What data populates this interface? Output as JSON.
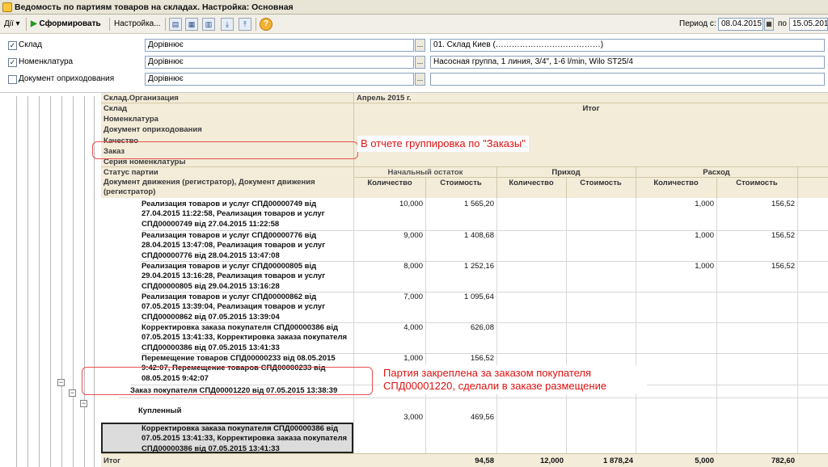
{
  "window": {
    "title": "Ведомость по партиям товаров на складах. Настройка: Основная"
  },
  "toolbar": {
    "actions_label": "Дії",
    "generate_label": "Сформировать",
    "settings_label": "Настройка...",
    "period_label": "Период с:",
    "period_from": "08.04.2015",
    "period_to_label": "по",
    "period_to": "15.05.2015"
  },
  "filters": [
    {
      "label": "Склад",
      "checked": true,
      "condition": "Дорівнює",
      "value": "01. Склад Киев (…………………………………)"
    },
    {
      "label": "Номенклатура",
      "checked": true,
      "condition": "Дорівнює",
      "value": "Насосная группа, 1 линия, 3/4\", 1-6 l/min, Wilo ST25/4"
    },
    {
      "label": "Документ оприходования",
      "checked": false,
      "condition": "Дорівнює",
      "value": ""
    }
  ],
  "report": {
    "row_headers": [
      "Склад.Организация",
      "Склад",
      "Номенклатура",
      "Документ оприходования",
      "Качество",
      "Заказ",
      "Серия номенклатуры",
      "Статус партии",
      "Документ движения (регистратор), Документ движения (регистратор)"
    ],
    "period": "Апрель 2015 г.",
    "itog_label": "Итог",
    "group_start": "Начальный остаток",
    "group_income": "Приход",
    "group_outgo": "Расход",
    "col_qty": "Количество",
    "col_cost": "Стоимость",
    "rows": [
      {
        "text": "Реализация товаров и услуг СПД00000749 від 27.04.2015 11:22:58, Реализация товаров и услуг СПД00000749 від 27.04.2015 11:22:58",
        "start_qty": "10,000",
        "start_cost": "1 565,20",
        "out_qty": "1,000",
        "out_cost": "156,52"
      },
      {
        "text": "Реализация товаров и услуг СПД00000776 від 28.04.2015 13:47:08, Реализация товаров и услуг СПД00000776 від 28.04.2015 13:47:08",
        "start_qty": "9,000",
        "start_cost": "1 408,68",
        "out_qty": "1,000",
        "out_cost": "156,52"
      },
      {
        "text": "Реализация товаров и услуг СПД00000805 від 29.04.2015 13:16:28, Реализация товаров и услуг СПД00000805 від 29.04.2015 13:16:28",
        "start_qty": "8,000",
        "start_cost": "1 252,16",
        "out_qty": "1,000",
        "out_cost": "156,52"
      },
      {
        "text": "Реализация товаров и услуг СПД00000862 від 07.05.2015 13:39:04, Реализация товаров и услуг СПД00000862 від 07.05.2015 13:39:04",
        "start_qty": "7,000",
        "start_cost": "1 095,64",
        "out_qty": "",
        "out_cost": ""
      },
      {
        "text": "Корректировка заказа покупателя СПД00000386 від 07.05.2015 13:41:33, Корректировка заказа покупателя СПД00000386 від 07.05.2015 13:41:33",
        "start_qty": "4,000",
        "start_cost": "626,08",
        "out_qty": "",
        "out_cost": ""
      },
      {
        "text": "Перемещение товаров СПД00000233 від 08.05.2015 9:42:07, Перемещение товаров СПД00000233 від 08.05.2015 9:42:07",
        "start_qty": "1,000",
        "start_cost": "156,52",
        "out_qty": "",
        "out_cost": ""
      }
    ],
    "order_row": "Заказ покупателя СПД00001220 від 07.05.2015 13:38:39",
    "status_row": "Купленный",
    "last_row": {
      "text": "Корректировка заказа покупателя СПД00000386 від 07.05.2015 13:41:33, Корректировка заказа покупателя СПД00000386 від 07.05.2015 13:41:33",
      "start_qty": "3,000",
      "start_cost": "469,56"
    },
    "total": {
      "label": "Итог",
      "start_cost": "94,58",
      "in_qty": "12,000",
      "in_cost": "1 878,24",
      "out_qty": "5,000",
      "out_cost": "782,60"
    }
  },
  "annotations": {
    "top": "В отчете группировка по \"Заказы\"",
    "bottom": "Партия закреплена за заказом покупателя СПД00001220, сделали в заказе размещение"
  },
  "colors": {
    "header_bg": "#f3ecd9",
    "annotation": "#e01010"
  }
}
